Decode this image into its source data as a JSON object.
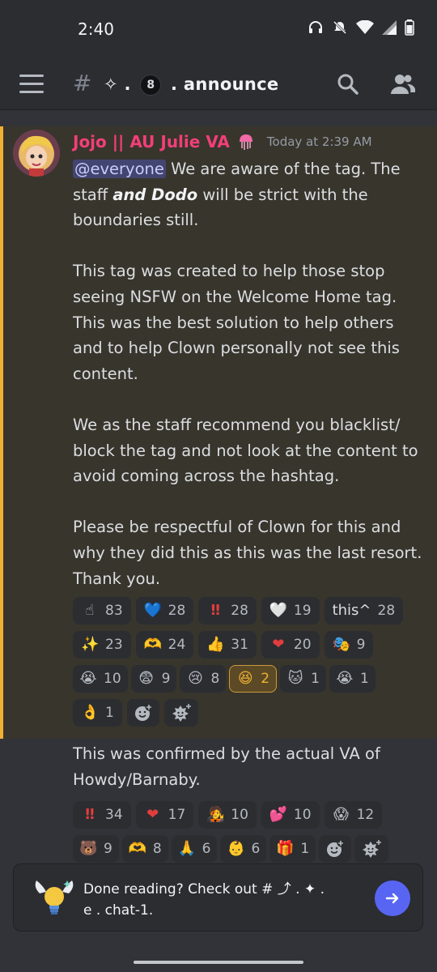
{
  "status_bar": {
    "time": "2:40"
  },
  "channel": {
    "hash": "#",
    "name_prefix": "✧ . ",
    "eight": "8",
    "name_suffix": " . announce"
  },
  "messages": [
    {
      "author": "Jojo || AU Julie VA",
      "author_color": "#f23f78",
      "timestamp": "Today at 2:39 AM",
      "mention": "@everyone",
      "p1_a": " We are aware of the tag. The staff ",
      "p1_em": "and Dodo",
      "p1_b": " will be strict with the boundaries still.",
      "p2": "This tag was created to help those stop seeing NSFW on the Welcome Home tag. This was the best solution to help others and to help Clown personally not see this content.",
      "p3": "We as the staff recommend you blacklist/ block the tag and not look at the content to avoid coming across the hashtag.",
      "p4": "Please be respectful of Clown for this and why they did this as this was the last resort. Thank you.",
      "reactions": [
        [
          {
            "emoji": "☝",
            "count": "83"
          },
          {
            "emoji": "💙",
            "count": "28"
          },
          {
            "emoji": "‼",
            "count": "28"
          },
          {
            "emoji": "🤍",
            "count": "19"
          },
          {
            "emoji": "this^",
            "count": "28"
          }
        ],
        [
          {
            "emoji": "✨",
            "count": "23"
          },
          {
            "emoji": "🫶",
            "count": "24"
          },
          {
            "emoji": "👍",
            "count": "31"
          },
          {
            "emoji": "❤",
            "count": "20"
          },
          {
            "emoji": "🎭",
            "count": "9"
          }
        ],
        [
          {
            "emoji": "😭",
            "count": "10"
          },
          {
            "emoji": "😨",
            "count": "9"
          },
          {
            "emoji": "😢",
            "count": "8"
          },
          {
            "emoji": "😆",
            "count": "2"
          },
          {
            "emoji": "🐱",
            "count": "1"
          },
          {
            "emoji": "😭",
            "count": "1"
          }
        ],
        [
          {
            "emoji": "👌",
            "count": "1"
          }
        ]
      ]
    },
    {
      "text": "This was confirmed by the actual VA of Howdy/Barnaby.",
      "reactions": [
        [
          {
            "emoji": "‼",
            "count": "34"
          },
          {
            "emoji": "❤",
            "count": "17"
          },
          {
            "emoji": "🧑‍🎤",
            "count": "10"
          },
          {
            "emoji": "💕",
            "count": "10"
          },
          {
            "emoji": "😱",
            "count": "12"
          }
        ],
        [
          {
            "emoji": "🐻",
            "count": "9"
          },
          {
            "emoji": "🫶",
            "count": "8"
          },
          {
            "emoji": "🙏",
            "count": "6"
          },
          {
            "emoji": "👶",
            "count": "6"
          },
          {
            "emoji": "🎁",
            "count": "1"
          }
        ]
      ]
    }
  ],
  "toast": {
    "line1": "Done reading? Check out # ⤴ . ✦ .",
    "line2": "e . chat-1."
  }
}
